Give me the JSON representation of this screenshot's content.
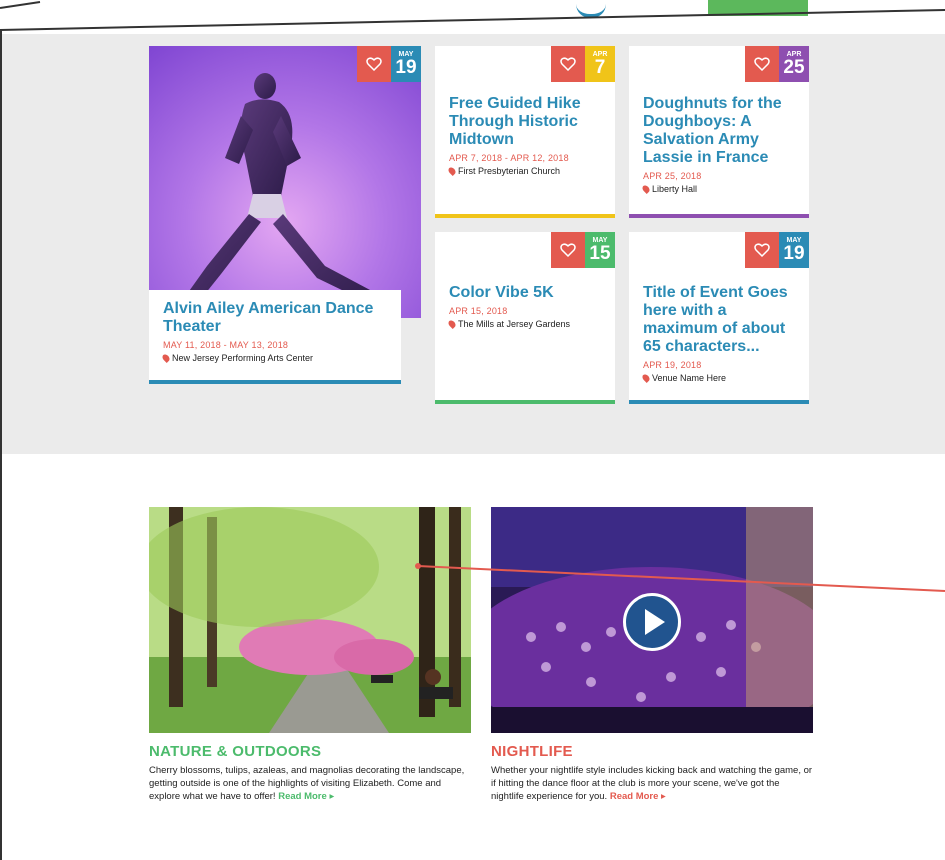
{
  "colors": {
    "blue": "#2b8bb5",
    "red": "#e35a4f",
    "yellow": "#f0c419",
    "purple": "#8e4fb0",
    "green": "#4cbb6c",
    "nature_green": "#4cbb6c",
    "nightlife_red": "#e35a4f"
  },
  "events": [
    {
      "title": "Alvin Ailey American Dance Theater",
      "dates": "MAY 11, 2018 - MAY 13, 2018",
      "venue": "New Jersey Performing Arts Center",
      "badge_month": "MAY",
      "badge_day": "19",
      "accent": "#2b8bb5",
      "favorite_icon": "heart-icon",
      "location_icon": "map-pin-icon"
    },
    {
      "title": "Free Guided Hike Through Historic Midtown",
      "dates": "APR 7, 2018 - APR 12, 2018",
      "venue": "First Presbyterian Church",
      "badge_month": "APR",
      "badge_day": "7",
      "accent": "#f0c419"
    },
    {
      "title": "Doughnuts for the Doughboys: A Salvation Army Lassie in France",
      "dates": "APR 25, 2018",
      "venue": "Liberty Hall",
      "badge_month": "APR",
      "badge_day": "25",
      "accent": "#8e4fb0"
    },
    {
      "title": "Color Vibe 5K",
      "dates": "APR 15, 2018",
      "venue": "The Mills at Jersey Gardens",
      "badge_month": "MAY",
      "badge_day": "15",
      "accent": "#4cbb6c"
    },
    {
      "title": "Title of Event Goes here with a maximum of about 65 characters...",
      "dates": "APR 19, 2018",
      "venue": "Venue Name Here",
      "badge_month": "MAY",
      "badge_day": "19",
      "accent": "#2b8bb5"
    }
  ],
  "features": [
    {
      "heading": "NATURE & OUTDOORS",
      "description": "Cherry blossoms, tulips, azaleas, and magnolias decorating the landscape, getting outside is one of the highlights of visiting Elizabeth. Come and explore what we have to offer!",
      "read_more": "Read More",
      "read_more_icon": "caret-right-icon",
      "color": "#4cbb6c"
    },
    {
      "heading": "NIGHTLIFE",
      "description": "Whether your nightlife style includes kicking back and watching the game, or if hitting the dance floor at the club is more your scene, we've got the nightlife experience for you.",
      "read_more": "Read More",
      "read_more_icon": "caret-right-icon",
      "color": "#e35a4f",
      "video_icon": "play-icon"
    }
  ]
}
